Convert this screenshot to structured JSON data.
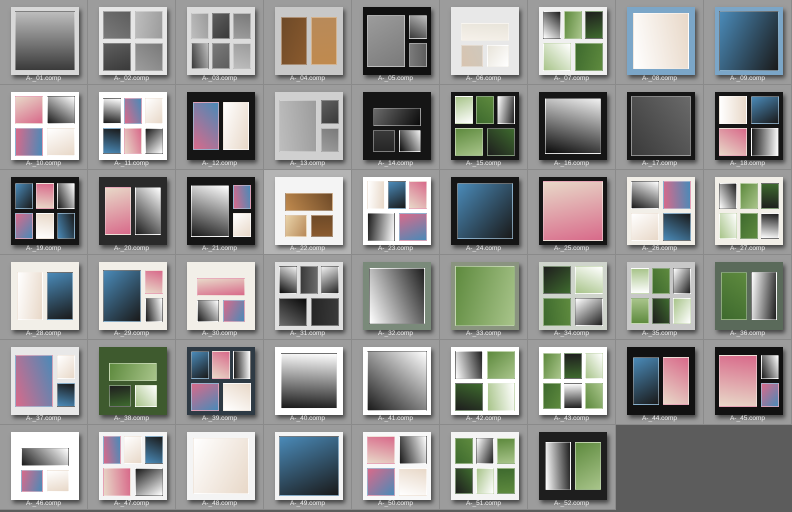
{
  "items": [
    {
      "label": "A-_01.comp",
      "bg": "#d8d8d8",
      "tone": "gray"
    },
    {
      "label": "A-_02.comp",
      "bg": "#e6e6e6",
      "tone": "gray"
    },
    {
      "label": "A-_03.comp",
      "bg": "#dcdcdc",
      "tone": "gray"
    },
    {
      "label": "A-_04.comp",
      "bg": "#c8c8c8",
      "tone": "warm"
    },
    {
      "label": "A-_05.comp",
      "bg": "#101010",
      "tone": "gray"
    },
    {
      "label": "A-_06.comp",
      "bg": "#e8e8e8",
      "tone": "bride"
    },
    {
      "label": "A-_07.comp",
      "bg": "#f0f0f0",
      "tone": "green"
    },
    {
      "label": "A-_08.comp",
      "bg": "#7ba6c8",
      "tone": "color"
    },
    {
      "label": "A-_09.comp",
      "bg": "#7ba6c8",
      "tone": "color"
    },
    {
      "label": "A-_10.comp",
      "bg": "#ffffff",
      "tone": "color"
    },
    {
      "label": "A-_11.comp",
      "bg": "#ffffff",
      "tone": "color"
    },
    {
      "label": "A-_12.comp",
      "bg": "#151515",
      "tone": "color"
    },
    {
      "label": "A-_13.comp",
      "bg": "#d0d0d0",
      "tone": "gray"
    },
    {
      "label": "A-_14.comp",
      "bg": "#151515",
      "tone": "dark"
    },
    {
      "label": "A-_15.comp",
      "bg": "#151515",
      "tone": "green"
    },
    {
      "label": "A-_16.comp",
      "bg": "#151515",
      "tone": "dark"
    },
    {
      "label": "A-_17.comp",
      "bg": "#151515",
      "tone": "dark"
    },
    {
      "label": "A-_18.comp",
      "bg": "#151515",
      "tone": "color"
    },
    {
      "label": "A-_19.comp",
      "bg": "#151515",
      "tone": "color"
    },
    {
      "label": "A-_20.comp",
      "bg": "#2a2a2a",
      "tone": "color"
    },
    {
      "label": "A-_21.comp",
      "bg": "#151515",
      "tone": "color"
    },
    {
      "label": "A-_22.comp",
      "bg": "#f4f4f4",
      "tone": "warm",
      "selected": true
    },
    {
      "label": "A-_23.comp",
      "bg": "#ffffff",
      "tone": "color"
    },
    {
      "label": "A-_24.comp",
      "bg": "#151515",
      "tone": "color"
    },
    {
      "label": "A-_25.comp",
      "bg": "#151515",
      "tone": "color"
    },
    {
      "label": "A-_26.comp",
      "bg": "#f2efe8",
      "tone": "color"
    },
    {
      "label": "A-_27.comp",
      "bg": "#f2efe8",
      "tone": "green"
    },
    {
      "label": "A-_28.comp",
      "bg": "#f2efe8",
      "tone": "color"
    },
    {
      "label": "A-_29.comp",
      "bg": "#f2efe8",
      "tone": "color"
    },
    {
      "label": "A-_30.comp",
      "bg": "#f2efe8",
      "tone": "color"
    },
    {
      "label": "A-_31.comp",
      "bg": "#e0e0e0",
      "tone": "dark"
    },
    {
      "label": "A-_32.comp",
      "bg": "#7a8a7a",
      "tone": "green"
    },
    {
      "label": "A-_33.comp",
      "bg": "#8a9480",
      "tone": "green"
    },
    {
      "label": "A-_34.comp",
      "bg": "#cfd4cc",
      "tone": "green"
    },
    {
      "label": "A-_35.comp",
      "bg": "#c8c8c8",
      "tone": "green"
    },
    {
      "label": "A-_36.comp",
      "bg": "#5a6a5a",
      "tone": "green"
    },
    {
      "label": "A-_37.comp",
      "bg": "#e8e8e8",
      "tone": "color"
    },
    {
      "label": "A-_38.comp",
      "bg": "#3e5a2e",
      "tone": "green"
    },
    {
      "label": "A-_39.comp",
      "bg": "#2e3a44",
      "tone": "color"
    },
    {
      "label": "A-_40.comp",
      "bg": "#ffffff",
      "tone": "blue"
    },
    {
      "label": "A-_41.comp",
      "bg": "#ffffff",
      "tone": "color"
    },
    {
      "label": "A-_42.comp",
      "bg": "#ffffff",
      "tone": "green"
    },
    {
      "label": "A-_43.comp",
      "bg": "#ffffff",
      "tone": "green"
    },
    {
      "label": "A-_44.comp",
      "bg": "#111111",
      "tone": "color"
    },
    {
      "label": "A-_45.comp",
      "bg": "#111111",
      "tone": "color"
    },
    {
      "label": "A-_46.comp",
      "bg": "#ffffff",
      "tone": "color"
    },
    {
      "label": "A-_47.comp",
      "bg": "#f4f4f4",
      "tone": "color"
    },
    {
      "label": "A-_48.comp",
      "bg": "#f4f4f4",
      "tone": "color"
    },
    {
      "label": "A-_49.comp",
      "bg": "#f4f4f4",
      "tone": "color"
    },
    {
      "label": "A-_50.comp",
      "bg": "#f8f8f8",
      "tone": "color"
    },
    {
      "label": "A-_51.comp",
      "bg": "#f4f4f4",
      "tone": "green"
    },
    {
      "label": "A-_52.comp",
      "bg": "#1e1e1e",
      "tone": "green"
    }
  ],
  "palette": {
    "gray": [
      "#3a3a3a",
      "#7a7a7a",
      "#bdbdbd",
      "#5e5e5e",
      "#9c9c9c"
    ],
    "warm": [
      "#8a5a2e",
      "#c08a4e",
      "#e8d2a8",
      "#6e4a28",
      "#b88a5a"
    ],
    "bride": [
      "#f6f1ea",
      "#d8c4b0",
      "#e8e4da",
      "#cfc8bc",
      "#ffffff"
    ],
    "green": [
      "#3e6a2e",
      "#ffffff",
      "#5e8a3e",
      "#1e1e1e",
      "#a8c48a"
    ],
    "color": [
      "#1a1a1a",
      "#d86a8a",
      "#ffffff",
      "#4a8ab8",
      "#e8d8c8"
    ],
    "dark": [
      "#0a0a0a",
      "#3a3a3a",
      "#f0f0f0",
      "#6a6a6a",
      "#252525"
    ],
    "blue": [
      "#4a7aa8",
      "#ffffff",
      "#2e4a2e",
      "#a8c8e8",
      "#1a1a1a"
    ]
  }
}
